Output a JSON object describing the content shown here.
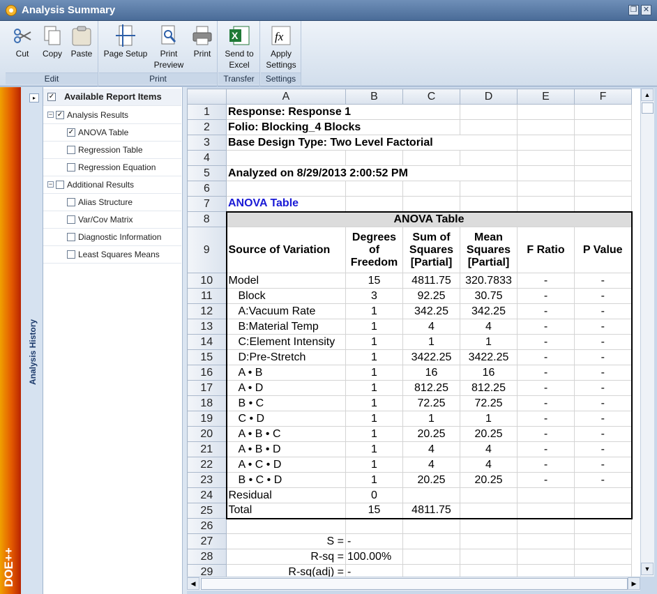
{
  "window": {
    "title": "Analysis Summary",
    "restore_symbol": "❐",
    "close_symbol": "✕"
  },
  "ribbon": {
    "groups": [
      {
        "label": "Edit",
        "buttons": [
          "Cut",
          "Copy",
          "Paste"
        ]
      },
      {
        "label": "Print",
        "buttons": [
          "Page Setup",
          "Print Preview",
          "Print"
        ]
      },
      {
        "label": "Transfer",
        "buttons": [
          "Send to Excel"
        ]
      },
      {
        "label": "Settings",
        "buttons": [
          "Apply Settings"
        ]
      }
    ]
  },
  "side": {
    "brand": "DOE++",
    "history_label": "Analysis History",
    "toggle_symbol": "▸"
  },
  "tree": {
    "header": "Available Report Items",
    "items": [
      {
        "label": "Analysis Results",
        "checked": true,
        "level": 0
      },
      {
        "label": "ANOVA Table",
        "checked": true,
        "level": 1
      },
      {
        "label": "Regression Table",
        "checked": false,
        "level": 1
      },
      {
        "label": "Regression Equation",
        "checked": false,
        "level": 1
      },
      {
        "label": "Additional Results",
        "checked": false,
        "level": 0
      },
      {
        "label": "Alias Structure",
        "checked": false,
        "level": 1
      },
      {
        "label": "Var/Cov Matrix",
        "checked": false,
        "level": 1
      },
      {
        "label": "Diagnostic Information",
        "checked": false,
        "level": 1
      },
      {
        "label": "Least Squares Means",
        "checked": false,
        "level": 1
      }
    ]
  },
  "sheet": {
    "columns": [
      "A",
      "B",
      "C",
      "D",
      "E",
      "F"
    ],
    "row_numbers": [
      "1",
      "2",
      "3",
      "4",
      "5",
      "6",
      "7",
      "8",
      "9",
      "10",
      "11",
      "12",
      "13",
      "14",
      "15",
      "16",
      "17",
      "18",
      "19",
      "20",
      "21",
      "22",
      "23",
      "24",
      "25",
      "26",
      "27",
      "28",
      "29"
    ],
    "header_lines": {
      "r1": "Response: Response 1",
      "r2": "Folio: Blocking_4 Blocks",
      "r3": "Base Design Type: Two Level Factorial",
      "r5": "Analyzed on 8/29/2013 2:00:52 PM",
      "r7": "ANOVA Table"
    },
    "anova_title": "ANOVA Table",
    "anova_headers": [
      "Source of Variation",
      "Degrees of Freedom",
      "Sum of Squares [Partial]",
      "Mean Squares [Partial]",
      "F Ratio",
      "P Value"
    ],
    "anova_rows": [
      [
        "Model",
        "15",
        "4811.75",
        "320.7833",
        "-",
        "-"
      ],
      [
        "Block",
        "3",
        "92.25",
        "30.75",
        "-",
        "-"
      ],
      [
        "A:Vacuum Rate",
        "1",
        "342.25",
        "342.25",
        "-",
        "-"
      ],
      [
        "B:Material Temp",
        "1",
        "4",
        "4",
        "-",
        "-"
      ],
      [
        "C:Element Intensity",
        "1",
        "1",
        "1",
        "-",
        "-"
      ],
      [
        "D:Pre-Stretch",
        "1",
        "3422.25",
        "3422.25",
        "-",
        "-"
      ],
      [
        "A • B",
        "1",
        "16",
        "16",
        "-",
        "-"
      ],
      [
        "A • D",
        "1",
        "812.25",
        "812.25",
        "-",
        "-"
      ],
      [
        "B • C",
        "1",
        "72.25",
        "72.25",
        "-",
        "-"
      ],
      [
        "C • D",
        "1",
        "1",
        "1",
        "-",
        "-"
      ],
      [
        "A • B • C",
        "1",
        "20.25",
        "20.25",
        "-",
        "-"
      ],
      [
        "A • B • D",
        "1",
        "4",
        "4",
        "-",
        "-"
      ],
      [
        "A • C • D",
        "1",
        "4",
        "4",
        "-",
        "-"
      ],
      [
        "B • C • D",
        "1",
        "20.25",
        "20.25",
        "-",
        "-"
      ],
      [
        "Residual",
        "0",
        "",
        "",
        "",
        ""
      ],
      [
        "Total",
        "15",
        "4811.75",
        "",
        "",
        ""
      ]
    ],
    "stats": [
      {
        "label": "S =",
        "value": "-"
      },
      {
        "label": "R-sq =",
        "value": "100.00%"
      },
      {
        "label": "R-sq(adj) =",
        "value": "-"
      }
    ],
    "link_color": "#1a1ad6"
  }
}
